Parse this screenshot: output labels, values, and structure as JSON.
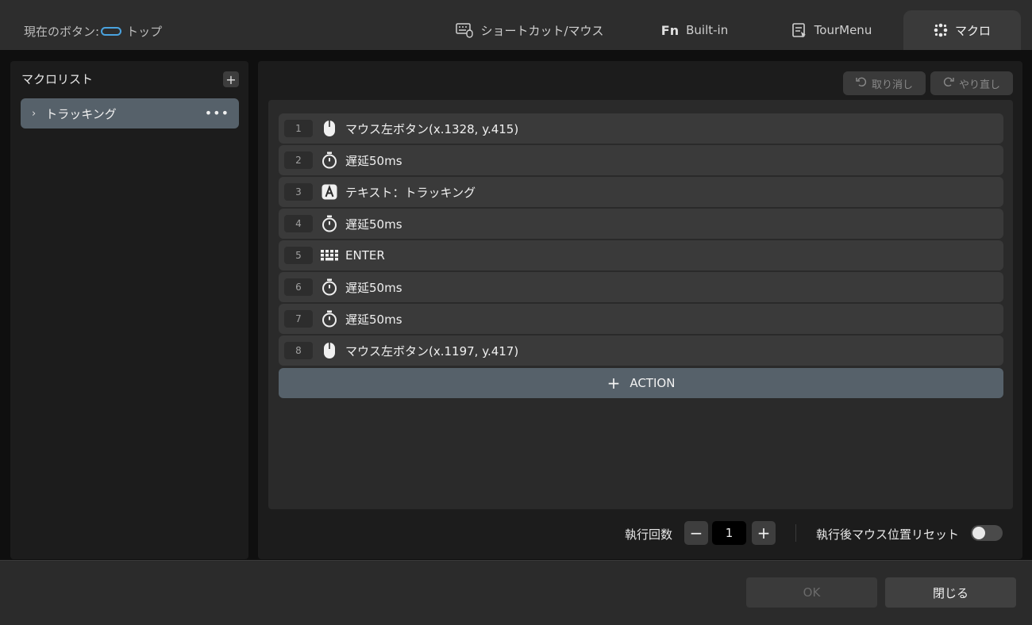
{
  "header": {
    "current_button_label": "現在のボタン:",
    "current_button_value": "トップ",
    "tabs": [
      {
        "label": "ショートカット/マウス",
        "icon": "keyboard-mouse-icon",
        "active": false
      },
      {
        "label": "Built-in",
        "icon": "fn-icon",
        "active": false
      },
      {
        "label": "TourMenu",
        "icon": "tourmenu-icon",
        "active": false
      },
      {
        "label": "マクロ",
        "icon": "macro-icon",
        "active": true
      }
    ],
    "accent_color": "#4aa3df"
  },
  "sidebar": {
    "title": "マクロリスト",
    "items": [
      {
        "name": "トラッキング",
        "selected": true
      }
    ]
  },
  "toolbar": {
    "undo_label": "取り消し",
    "redo_label": "やり直し"
  },
  "actions": [
    {
      "num": "1",
      "icon": "mouse-icon",
      "text": "マウス左ボタン(x.1328, y.415)"
    },
    {
      "num": "2",
      "icon": "timer-icon",
      "text": "遅延50ms"
    },
    {
      "num": "3",
      "icon": "text-a-icon",
      "text": "テキスト：トラッキング"
    },
    {
      "num": "4",
      "icon": "timer-icon",
      "text": "遅延50ms"
    },
    {
      "num": "5",
      "icon": "keyboard-icon",
      "text": "ENTER"
    },
    {
      "num": "6",
      "icon": "timer-icon",
      "text": "遅延50ms"
    },
    {
      "num": "7",
      "icon": "timer-icon",
      "text": "遅延50ms"
    },
    {
      "num": "8",
      "icon": "mouse-icon",
      "text": "マウス左ボタン(x.1197, y.417)"
    }
  ],
  "add_action_label": "ACTION",
  "execution": {
    "label": "執行回数",
    "count": "1",
    "reset_label": "執行後マウス位置リセット",
    "reset_enabled": false
  },
  "footer": {
    "ok_label": "OK",
    "close_label": "閉じる"
  }
}
